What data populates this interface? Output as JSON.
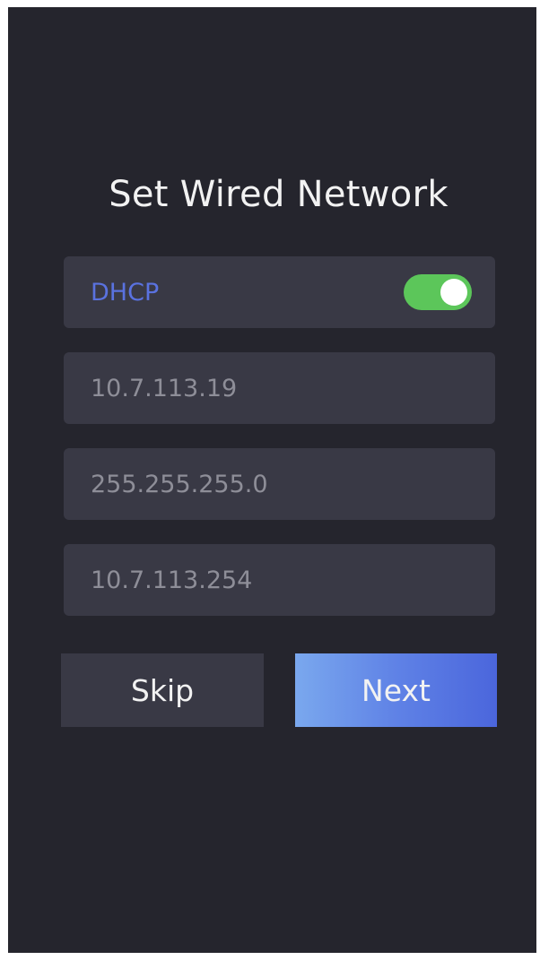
{
  "title": "Set Wired Network",
  "dhcp": {
    "label": "DHCP",
    "enabled": true,
    "toggle_color": "#5cc65a"
  },
  "fields": {
    "ip_address": "10.7.113.19",
    "subnet_mask": "255.255.255.0",
    "gateway": "10.7.113.254"
  },
  "buttons": {
    "skip": "Skip",
    "next": "Next"
  },
  "colors": {
    "background": "#25252d",
    "field_background": "#393945",
    "accent": "#5a72e0"
  }
}
